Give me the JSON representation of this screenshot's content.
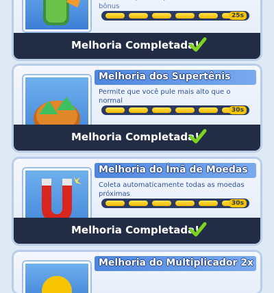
{
  "cards": [
    {
      "title": "",
      "desc": "Leva você pro céu para coletar moedas bônus",
      "timer": "25s",
      "status": "Melhoria Completada!",
      "item_icon": "jetpack-icon"
    },
    {
      "title": "Melhoria dos Supertênis",
      "desc": "Permite que você pule mais alto que o normal",
      "timer": "30s",
      "status": "Melhoria Completada!",
      "item_icon": "super-sneakers-icon"
    },
    {
      "title": "Melhoria do Ímã de Moedas",
      "desc": "Coleta automaticamente todas as moedas próximas",
      "timer": "30s",
      "status": "Melhoria Completada!",
      "item_icon": "coin-magnet-icon"
    },
    {
      "title": "Melhoria do Multiplicador 2x",
      "desc": "",
      "timer": "",
      "status": "",
      "item_icon": "multiplier-icon"
    }
  ],
  "progress_segments": 6,
  "colors": {
    "accent": "#4e86de",
    "footer": "#222d45",
    "check": "#7ed321",
    "progress": "#f6c400"
  }
}
